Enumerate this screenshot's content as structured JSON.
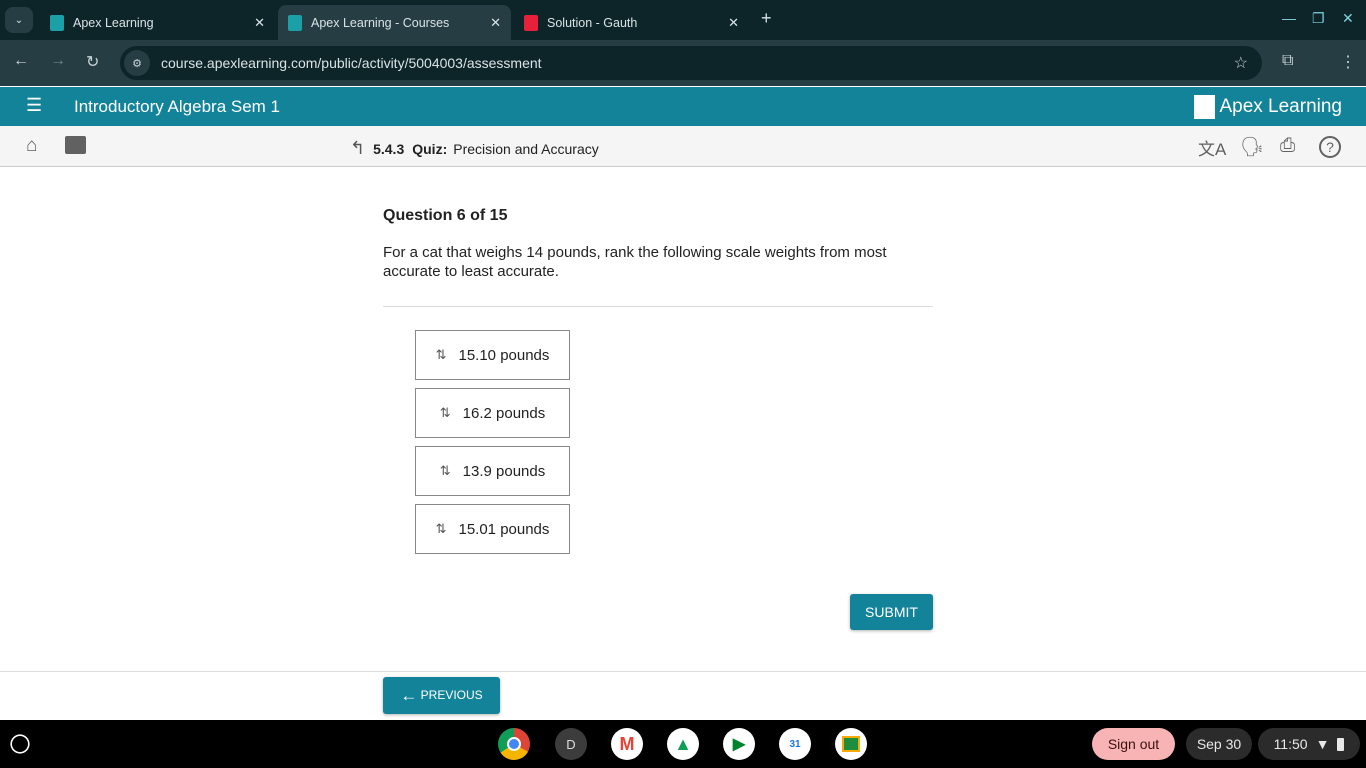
{
  "browser": {
    "tabs": [
      {
        "title": "Apex Learning",
        "active": false
      },
      {
        "title": "Apex Learning - Courses",
        "active": true
      },
      {
        "title": "Solution - Gauth",
        "active": false
      }
    ],
    "url": "course.apexlearning.com/public/activity/5004003/assessment"
  },
  "app": {
    "title": "Introductory Algebra Sem 1",
    "logo": "Apex Learning",
    "accent": "#13839a"
  },
  "breadcrumb": {
    "number": "5.4.3",
    "type": "Quiz:",
    "name": "Precision and Accuracy"
  },
  "question": {
    "number": "Question 6 of 15",
    "text": "For a cat that weighs 14 pounds, rank the following scale weights from most accurate to least accurate.",
    "options": [
      "15.10 pounds",
      "16.2 pounds",
      "13.9 pounds",
      "15.01 pounds"
    ]
  },
  "buttons": {
    "submit": "SUBMIT",
    "previous": "PREVIOUS"
  },
  "shelf": {
    "profile_letter": "D",
    "sign_out": "Sign out",
    "date": "Sep 30",
    "time": "11:50"
  }
}
